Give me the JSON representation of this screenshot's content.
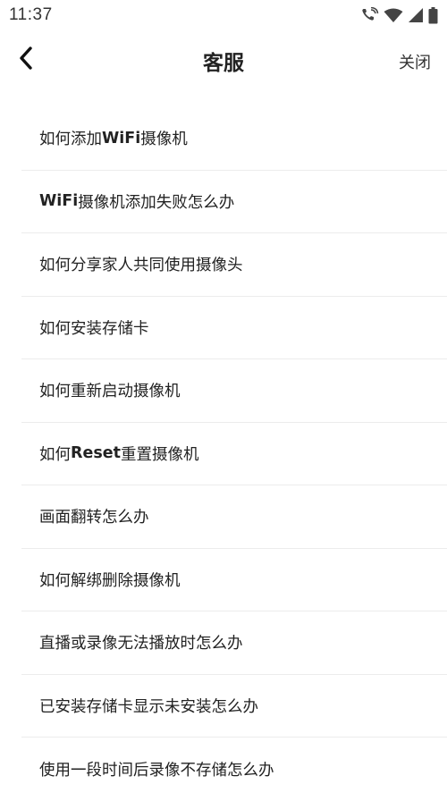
{
  "status_bar": {
    "time": "11:37",
    "icons": [
      "wifi-call-icon",
      "wifi-signal-icon",
      "cellular-signal-icon",
      "battery-icon"
    ]
  },
  "header": {
    "back_icon": "chevron-left-icon",
    "title": "客服",
    "close_label": "关闭"
  },
  "faq": {
    "items": [
      {
        "pre": "如何添加",
        "bold": "WiFi",
        "post": "摄像机"
      },
      {
        "pre": "",
        "bold": "WiFi",
        "post": "摄像机添加失败怎么办"
      },
      {
        "pre": "如何分享家人共同使用摄像头",
        "bold": "",
        "post": ""
      },
      {
        "pre": "如何安装存储卡",
        "bold": "",
        "post": ""
      },
      {
        "pre": "如何重新启动摄像机",
        "bold": "",
        "post": ""
      },
      {
        "pre": "如何",
        "bold": "Reset",
        "post": "重置摄像机"
      },
      {
        "pre": "画面翻转怎么办",
        "bold": "",
        "post": ""
      },
      {
        "pre": "如何解绑删除摄像机",
        "bold": "",
        "post": ""
      },
      {
        "pre": "直播或录像无法播放时怎么办",
        "bold": "",
        "post": ""
      },
      {
        "pre": "已安装存储卡显示未安装怎么办",
        "bold": "",
        "post": ""
      },
      {
        "pre": "使用一段时间后录像不存储怎么办",
        "bold": "",
        "post": ""
      }
    ]
  }
}
